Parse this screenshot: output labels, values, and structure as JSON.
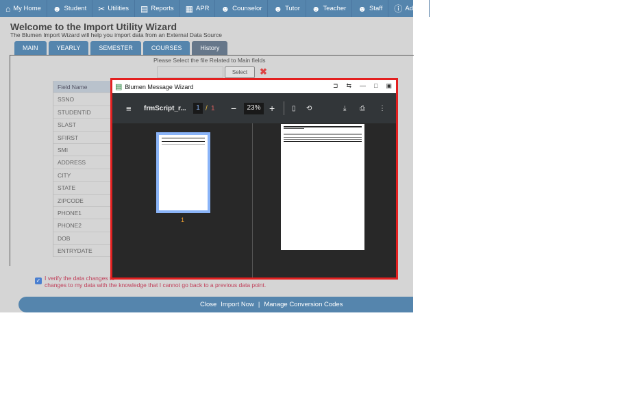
{
  "nav": [
    {
      "label": "My Home",
      "icon": "home-icon",
      "glyph": "⌂"
    },
    {
      "label": "Student",
      "icon": "student-icon",
      "glyph": "☻"
    },
    {
      "label": "Utilities",
      "icon": "tools-icon",
      "glyph": "✂"
    },
    {
      "label": "Reports",
      "icon": "reports-icon",
      "glyph": "▤"
    },
    {
      "label": "APR",
      "icon": "apr-icon",
      "glyph": "▦"
    },
    {
      "label": "Counselor",
      "icon": "counselor-icon",
      "glyph": "☻"
    },
    {
      "label": "Tutor",
      "icon": "tutor-icon",
      "glyph": "☻"
    },
    {
      "label": "Teacher",
      "icon": "teacher-icon",
      "glyph": "☻"
    },
    {
      "label": "Staff",
      "icon": "staff-icon",
      "glyph": "☻"
    },
    {
      "label": "Admin",
      "icon": "admin-icon",
      "glyph": "ⓘ"
    }
  ],
  "title": "Welcome to the Import Utility Wizard",
  "subtitle": "The Blumen Import Wizard will help you import data from an External Data Source",
  "tabs": [
    "MAIN",
    "YEARLY",
    "SEMESTER",
    "COURSES",
    "History"
  ],
  "prompt": "Please Select the file Related to Main fields",
  "select_label": "Select",
  "table": {
    "header": "Field Name",
    "rows": [
      "SSNO",
      "STUDENTID",
      "SLAST",
      "SFIRST",
      "SMI",
      "ADDRESS",
      "CITY",
      "STATE",
      "ZIPCODE",
      "PHONE1",
      "PHONE2",
      "DOB",
      "ENTRYDATE"
    ]
  },
  "dialog": {
    "title": "Blumen Message Wizard",
    "filename": "frmScript_r...",
    "page": "1",
    "pages": "1",
    "zoom": "23%",
    "thumb_page": "1"
  },
  "verify": {
    "line1": "I verify the data changes to",
    "line2": "changes to my data with the knowledge that I cannot go back to a previous data point.",
    "checked": true
  },
  "footer": {
    "close": "Close",
    "import": "Import Now",
    "sep": "|",
    "manage": "Manage Conversion Codes"
  },
  "colors": {
    "nav": "#5585ad",
    "dialog_border": "#e32020"
  }
}
